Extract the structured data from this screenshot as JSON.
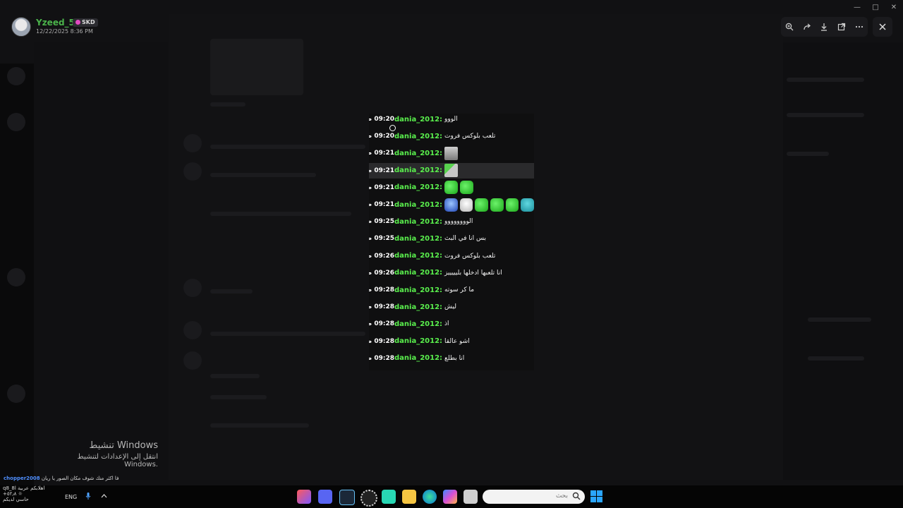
{
  "viewer": {
    "uploader_name": "Yzeed_5ll",
    "badge_text": "SKD",
    "timestamp": "12/22/2025 8:36 PM",
    "toolbar_icons": [
      "zoom-in-icon",
      "forward-icon",
      "download-icon",
      "open-external-icon",
      "more-icon"
    ],
    "close_icon": "close-icon"
  },
  "image_chat": {
    "rows": [
      {
        "time": "09:20 ص",
        "name": "dania_2012:",
        "msg": "الووو",
        "emoji": []
      },
      {
        "time": "09:20 ص",
        "name": "dania_2012:",
        "msg": "تلعب بلوكس فروت",
        "emoji": []
      },
      {
        "time": "09:21 ص",
        "name": "dania_2012:",
        "msg": "",
        "emoji": [
          "e-face"
        ]
      },
      {
        "time": "09:21 ص",
        "name": "dania_2012:",
        "msg": "",
        "emoji": [
          "e-dog"
        ]
      },
      {
        "time": "09:21 ص",
        "name": "dania_2012:",
        "msg": "",
        "emoji": [
          "e-green",
          "e-green"
        ]
      },
      {
        "time": "09:21 ص",
        "name": "dania_2012:",
        "msg": "",
        "emoji": [
          "e-blue",
          "e-white",
          "e-green",
          "e-green",
          "e-green",
          "e-teal"
        ]
      },
      {
        "time": "09:25 ص",
        "name": "dania_2012:",
        "msg": "الوووووووو",
        "emoji": []
      },
      {
        "time": "09:25 ص",
        "name": "dania_2012:",
        "msg": "بس انا في البث",
        "emoji": []
      },
      {
        "time": "09:26 ص",
        "name": "dania_2012:",
        "msg": "تلعب بلوكس فروت",
        "emoji": []
      },
      {
        "time": "09:26 ص",
        "name": "dania_2012:",
        "msg": "انا تلعبها ادخلها بليييييز",
        "emoji": []
      },
      {
        "time": "09:28 ص",
        "name": "dania_2012:",
        "msg": "ما كر سوته",
        "emoji": []
      },
      {
        "time": "09:28 ص",
        "name": "dania_2012:",
        "msg": "ليش",
        "emoji": []
      },
      {
        "time": "09:28 ص",
        "name": "dania_2012:",
        "msg": "اذ",
        "emoji": []
      },
      {
        "time": "09:28 ص",
        "name": "dania_2012:",
        "msg": "اشو عالقا",
        "emoji": []
      },
      {
        "time": "09:28 ص",
        "name": "dania_2012:",
        "msg": "انا بطلع",
        "emoji": []
      }
    ]
  },
  "activate_windows": {
    "title": "تنشيط Windows",
    "subtitle": "انتقل إلى الإعدادات لتنشيط Windows."
  },
  "notification": {
    "user": "chopper2008",
    "text": "فا اكثر منك شوف مكان الصور يا ريان"
  },
  "tray_left": {
    "line1": "q8_8l اهلابكم عربية",
    "line2": "+٥٢٫٨ ☼",
    "line3": "حاسي لديكم"
  },
  "taskbar": {
    "language": "ENG",
    "search_placeholder": "بحث",
    "apps": [
      "capcut-icon",
      "discord-icon",
      "steam-icon",
      "settings-gear-icon",
      "chat-app-icon",
      "folder-icon",
      "edge-icon",
      "copilot-icon",
      "window-app-icon"
    ]
  }
}
